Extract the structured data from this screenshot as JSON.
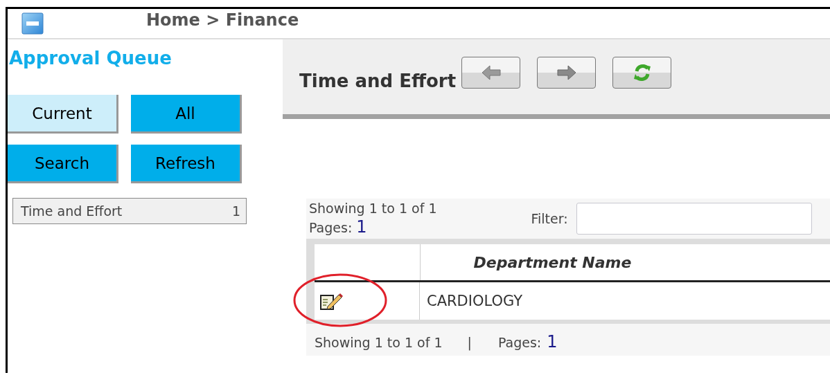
{
  "header": {
    "breadcrumb": "Home > Finance"
  },
  "sidebar": {
    "title": "Approval Queue",
    "buttons": [
      {
        "label": "Current",
        "selected": true
      },
      {
        "label": "All",
        "selected": false
      },
      {
        "label": "Search",
        "selected": false
      },
      {
        "label": "Refresh",
        "selected": false
      }
    ],
    "queue": [
      {
        "label": "Time and Effort",
        "count": "1"
      }
    ]
  },
  "main": {
    "title": "Time and Effort",
    "toolbar": [
      {
        "kind": "back"
      },
      {
        "kind": "forward"
      },
      {
        "kind": "reload"
      }
    ],
    "table": {
      "info": "Showing 1 to 1 of 1",
      "pages_label": "Pages:",
      "pages": "1",
      "filter_label": "Filter:",
      "columns": [
        "Department Name"
      ],
      "rows": [
        {
          "kind": "edit",
          "name": "CARDIOLOGY",
          "highlighted": true
        }
      ],
      "footer_info": "Showing 1 to 1 of 1",
      "footer_separator": "|",
      "footer_pages_label": "Pages:",
      "footer_pages": "1"
    }
  }
}
